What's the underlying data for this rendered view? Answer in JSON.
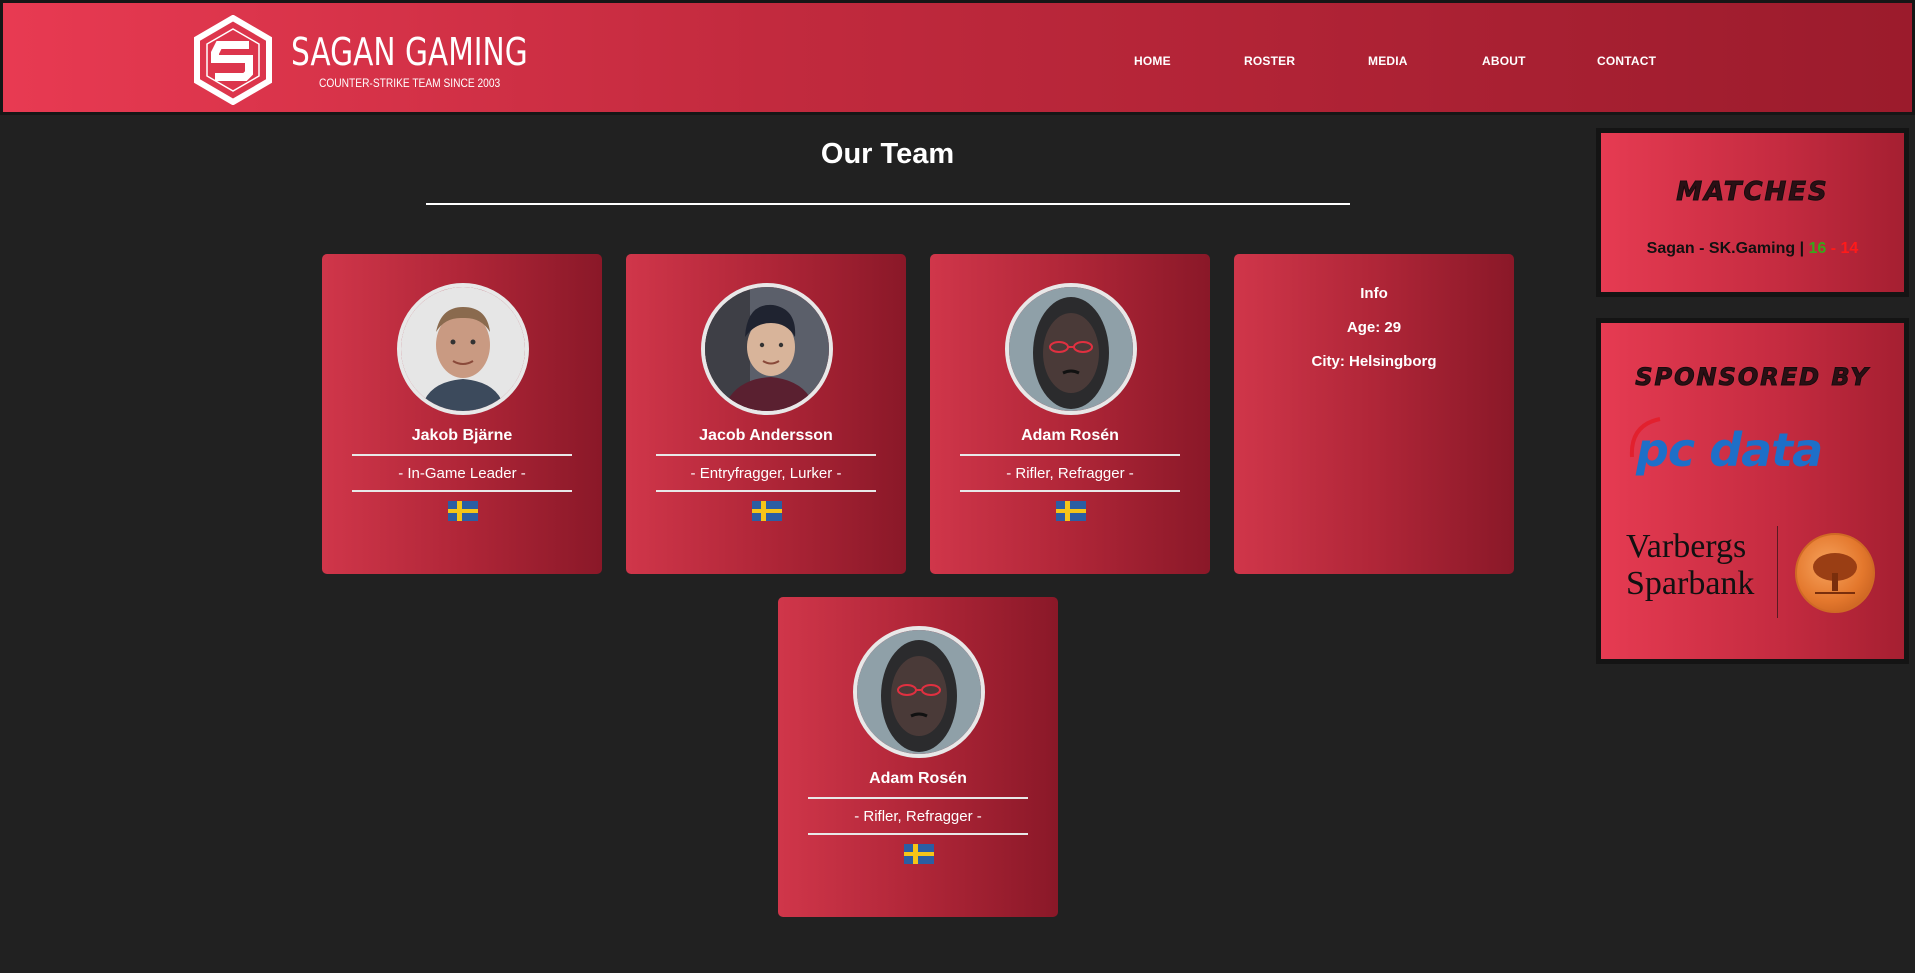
{
  "header": {
    "brand_name": "SAGAN GAMING",
    "brand_tagline": "COUNTER-STRIKE TEAM SINCE 2003",
    "nav": [
      "HOME",
      "ROSTER",
      "MEDIA",
      "ABOUT",
      "CONTACT"
    ]
  },
  "main": {
    "title": "Our Team",
    "players": [
      {
        "name": "Jakob Bjärne",
        "role": "- In-Game Leader -"
      },
      {
        "name": "Jacob Andersson",
        "role": "- Entryfragger, Lurker -"
      },
      {
        "name": "Adam Rosén",
        "role": "- Rifler, Refragger -"
      },
      {
        "name": "Adam Rosén",
        "role": "- Rifler, Refragger -"
      }
    ],
    "info": {
      "heading": "Info",
      "age": "Age: 29",
      "city": "City: Helsingborg"
    }
  },
  "sidebar": {
    "matches_heading": "MATCHES",
    "match_teams": "Sagan - SK.Gaming  |",
    "score_home": "16",
    "score_separator": "-",
    "score_away": "14",
    "sponsors_heading": "SPONSORED BY",
    "sponsor_1": "pc data",
    "sponsor_2": "Varbergs Sparbank"
  },
  "colors": {
    "accent": "#c22a3e",
    "background": "#212121",
    "win": "#39a71b",
    "loss": "#ff1a1a"
  },
  "icons": {
    "flag": "sweden-flag-icon",
    "logo": "sagan-hexagon-logo"
  }
}
